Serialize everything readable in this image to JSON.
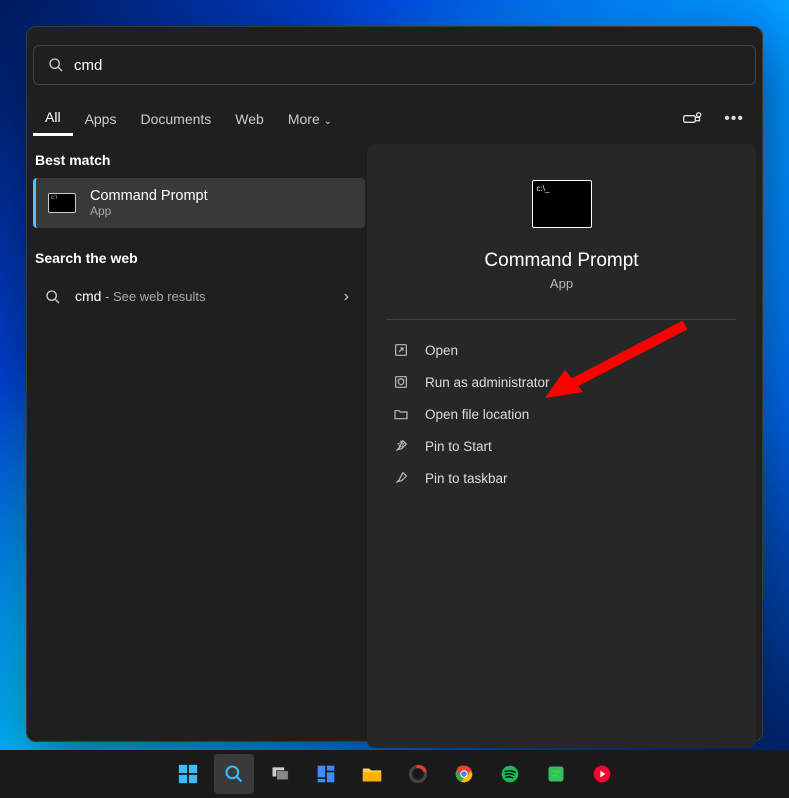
{
  "search": {
    "query": "cmd"
  },
  "tabs": {
    "all": "All",
    "apps": "Apps",
    "documents": "Documents",
    "web": "Web",
    "more": "More"
  },
  "left": {
    "best_match_header": "Best match",
    "result_title": "Command Prompt",
    "result_sub": "App",
    "search_web_header": "Search the web",
    "web_query": "cmd",
    "web_suffix": " - See web results"
  },
  "hero": {
    "title": "Command Prompt",
    "sub": "App"
  },
  "actions": {
    "open": "Open",
    "admin": "Run as administrator",
    "location": "Open file location",
    "pin_start": "Pin to Start",
    "pin_taskbar": "Pin to taskbar"
  }
}
